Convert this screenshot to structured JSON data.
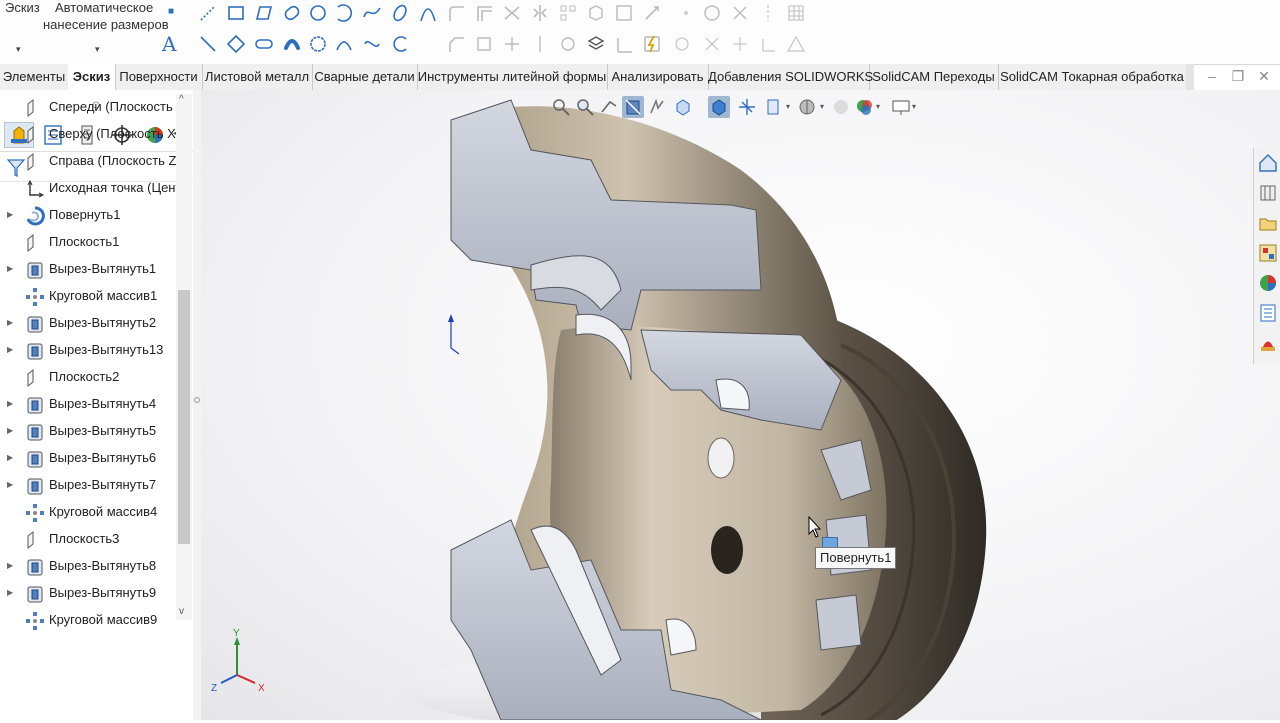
{
  "ribbon": {
    "sketch_label": "Эскиз",
    "auto_dim_line1": "Автоматическое",
    "auto_dim_line2": "нанесение размеров"
  },
  "tabs": [
    {
      "label": "Элементы",
      "active": false
    },
    {
      "label": "Эскиз",
      "active": true
    },
    {
      "label": "Поверхности",
      "active": false
    },
    {
      "label": "Листовой металл",
      "active": false
    },
    {
      "label": "Сварные детали",
      "active": false
    },
    {
      "label": "Инструменты литейной формы",
      "active": false
    },
    {
      "label": "Анализировать",
      "active": false
    },
    {
      "label": "Добавления SOLIDWORKS",
      "active": false
    },
    {
      "label": "SolidCAM Переходы",
      "active": false
    },
    {
      "label": "SolidCAM Токарная обработка",
      "active": false
    }
  ],
  "tree": {
    "items": [
      {
        "label": "Спереди (Плоскость XY",
        "icon": "plane-icon",
        "expandable": false
      },
      {
        "label": "Сверху (Плоскость XZ)",
        "icon": "plane-icon",
        "expandable": false
      },
      {
        "label": "Справа (Плоскость ZY)",
        "icon": "plane-icon",
        "expandable": false
      },
      {
        "label": "Исходная точка (Центр",
        "icon": "origin-icon",
        "expandable": false
      },
      {
        "label": "Повернуть1",
        "icon": "revolve-icon",
        "expandable": true
      },
      {
        "label": "Плоскость1",
        "icon": "plane-icon",
        "expandable": false
      },
      {
        "label": "Вырез-Вытянуть1",
        "icon": "extrude-cut-icon",
        "expandable": true
      },
      {
        "label": "Круговой массив1",
        "icon": "circular-pattern-icon",
        "expandable": false
      },
      {
        "label": "Вырез-Вытянуть2",
        "icon": "extrude-cut-icon",
        "expandable": true
      },
      {
        "label": "Вырез-Вытянуть13",
        "icon": "extrude-cut-icon",
        "expandable": true
      },
      {
        "label": "Плоскость2",
        "icon": "plane-icon",
        "expandable": false
      },
      {
        "label": "Вырез-Вытянуть4",
        "icon": "extrude-cut-icon",
        "expandable": true
      },
      {
        "label": "Вырез-Вытянуть5",
        "icon": "extrude-cut-icon",
        "expandable": true
      },
      {
        "label": "Вырез-Вытянуть6",
        "icon": "extrude-cut-icon",
        "expandable": true
      },
      {
        "label": "Вырез-Вытянуть7",
        "icon": "extrude-cut-icon",
        "expandable": true
      },
      {
        "label": "Круговой массив4",
        "icon": "circular-pattern-icon",
        "expandable": false
      },
      {
        "label": "Плоскость3",
        "icon": "plane-icon",
        "expandable": false
      },
      {
        "label": "Вырез-Вытянуть8",
        "icon": "extrude-cut-icon",
        "expandable": true
      },
      {
        "label": "Вырез-Вытянуть9",
        "icon": "extrude-cut-icon",
        "expandable": true
      },
      {
        "label": "Круговой массив9",
        "icon": "circular-pattern-icon",
        "expandable": false
      }
    ]
  },
  "viewport": {
    "tooltip": "Повернуть1",
    "triad": {
      "x": "X",
      "y": "Y",
      "z": "Z"
    }
  },
  "colors": {
    "part_surface": "#b5a794",
    "section_face": "#c8cdd8",
    "accent": "#2e6fc0"
  }
}
